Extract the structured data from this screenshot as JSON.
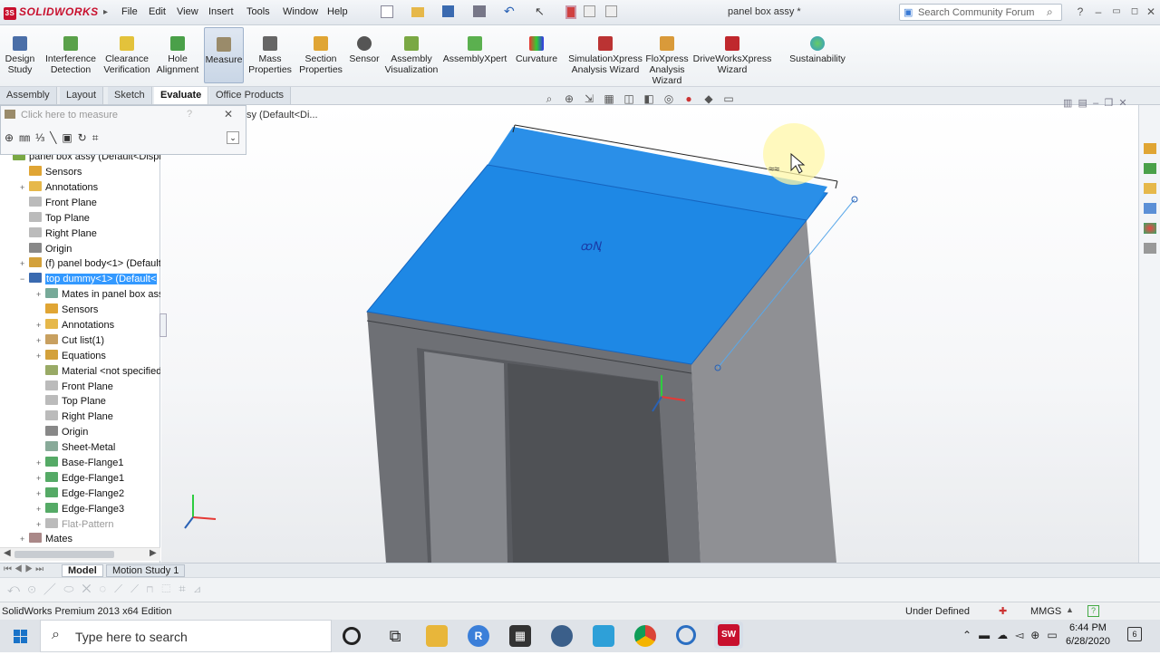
{
  "titlebar": {
    "app_name": "SOLIDWORKS",
    "menus": [
      "File",
      "Edit",
      "View",
      "Insert",
      "Tools",
      "Window",
      "Help"
    ],
    "document_title": "panel box assy *",
    "search_placeholder": "Search Community Forum"
  },
  "commands": [
    {
      "label": "Design\nStudy"
    },
    {
      "label": "Interference\nDetection"
    },
    {
      "label": "Clearance\nVerification"
    },
    {
      "label": "Hole\nAlignment"
    },
    {
      "label": "Measure"
    },
    {
      "label": "Mass\nProperties"
    },
    {
      "label": "Section\nProperties"
    },
    {
      "label": "Sensor"
    },
    {
      "label": "Assembly\nVisualization"
    },
    {
      "label": "AssemblyXpert"
    },
    {
      "label": "Curvature"
    },
    {
      "label": "SimulationXpress\nAnalysis Wizard"
    },
    {
      "label": "FloXpress\nAnalysis\nWizard"
    },
    {
      "label": "DriveWorksXpress\nWizard"
    },
    {
      "label": "Sustainability"
    }
  ],
  "tabs": [
    "Assembly",
    "Layout",
    "Sketch",
    "Evaluate",
    "Office Products"
  ],
  "measure": {
    "hint": "Click here to measure"
  },
  "config_label": "sy (Default<Di...",
  "tree": [
    "panel box assy  (Default<Displa",
    "Sensors",
    "Annotations",
    "Front Plane",
    "Top Plane",
    "Right Plane",
    "Origin",
    "(f) panel body<1> (Default<",
    "top dummy<1> (Default<",
    "Mates in panel box assy",
    "Sensors",
    "Annotations",
    "Cut list(1)",
    "Equations",
    "Material <not specified>",
    "Front Plane",
    "Top Plane",
    "Right Plane",
    "Origin",
    "Sheet-Metal",
    "Base-Flange1",
    "Edge-Flange1",
    "Edge-Flange2",
    "Edge-Flange3",
    "Flat-Pattern",
    "Mates"
  ],
  "model_tabs": [
    "Model",
    "Motion Study 1"
  ],
  "status": {
    "edition": "SolidWorks Premium 2013 x64 Edition",
    "state": "Under Defined",
    "units": "MMGS"
  },
  "taskbar": {
    "search_placeholder": "Type here to search",
    "time": "6:44 PM",
    "date": "6/28/2020"
  },
  "colors": {
    "accent": "#1e88e5",
    "selection": "#3399ff",
    "brand": "#c8102e"
  }
}
